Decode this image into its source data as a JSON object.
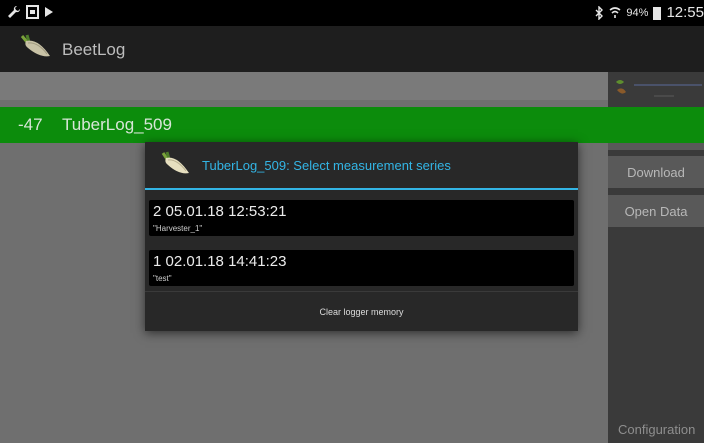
{
  "status_bar": {
    "left_icons": [
      "wrench-icon",
      "screenshot-icon",
      "play-icon"
    ],
    "right_icons": [
      "bluetooth-icon",
      "wifi-icon"
    ],
    "battery": "94%",
    "time": "12:55"
  },
  "action_bar": {
    "title": "BeetLog",
    "icon": "beet-logo-icon"
  },
  "logger_row": {
    "rssi": "-47",
    "name": "TuberLog_509"
  },
  "sidebar": {
    "buttons": [
      "Measurement",
      "Download",
      "Open Data"
    ],
    "configuration": "Configuration"
  },
  "dialog": {
    "title": "TuberLog_509: Select measurement series",
    "series": [
      {
        "line1": "2  05.01.18 12:53:21",
        "line2": "\"Harvester_1\""
      },
      {
        "line1": "1  02.01.18 14:41:23",
        "line2": "\"test\""
      }
    ],
    "clear_button": "Clear logger memory"
  },
  "colors": {
    "accent": "#33b5e5",
    "logger_row_bg": "#0c8c0c",
    "dialog_bg": "#282828"
  }
}
